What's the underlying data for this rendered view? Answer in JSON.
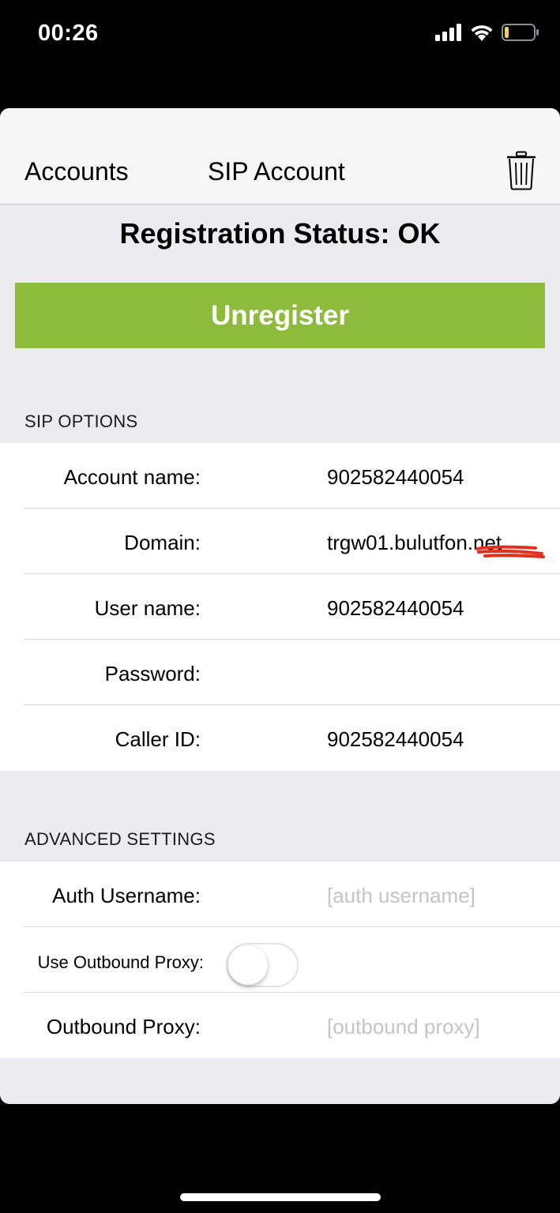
{
  "status_bar": {
    "time": "00:26",
    "battery_level": 0.15,
    "battery_color": "#f7ce46"
  },
  "nav": {
    "back_label": "Accounts",
    "title": "SIP Account",
    "trash_icon": "trash-icon"
  },
  "registration": {
    "status_text": "Registration Status: OK"
  },
  "unregister_button": {
    "label": "Unregister",
    "color": "#8dbb3c"
  },
  "sip_options": {
    "header": "SIP OPTIONS",
    "rows": [
      {
        "label": "Account name:",
        "value": "902582440054"
      },
      {
        "label": "Domain:",
        "value": "trgw01.bulutfon.net"
      },
      {
        "label": "User name:",
        "value": "902582440054"
      },
      {
        "label": "Password:",
        "value": ""
      },
      {
        "label": "Caller ID:",
        "value": "902582440054"
      }
    ]
  },
  "advanced_settings": {
    "header": "ADVANCED SETTINGS",
    "auth_username": {
      "label": "Auth Username:",
      "placeholder": "[auth username]"
    },
    "use_outbound_proxy": {
      "label": "Use Outbound Proxy:",
      "enabled": false
    },
    "outbound_proxy": {
      "label": "Outbound Proxy:",
      "placeholder": "[outbound proxy]"
    }
  },
  "annotation_color": "#e0301e"
}
